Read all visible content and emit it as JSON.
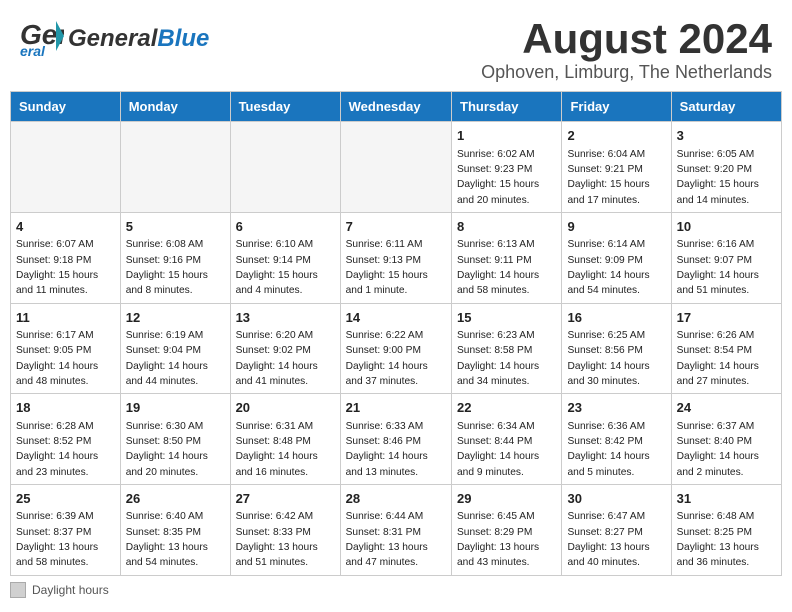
{
  "header": {
    "logo_general": "General",
    "logo_blue": "Blue",
    "month_year": "August 2024",
    "location": "Ophoven, Limburg, The Netherlands"
  },
  "weekdays": [
    "Sunday",
    "Monday",
    "Tuesday",
    "Wednesday",
    "Thursday",
    "Friday",
    "Saturday"
  ],
  "weeks": [
    [
      {
        "day": "",
        "info": ""
      },
      {
        "day": "",
        "info": ""
      },
      {
        "day": "",
        "info": ""
      },
      {
        "day": "",
        "info": ""
      },
      {
        "day": "1",
        "info": "Sunrise: 6:02 AM\nSunset: 9:23 PM\nDaylight: 15 hours\nand 20 minutes."
      },
      {
        "day": "2",
        "info": "Sunrise: 6:04 AM\nSunset: 9:21 PM\nDaylight: 15 hours\nand 17 minutes."
      },
      {
        "day": "3",
        "info": "Sunrise: 6:05 AM\nSunset: 9:20 PM\nDaylight: 15 hours\nand 14 minutes."
      }
    ],
    [
      {
        "day": "4",
        "info": "Sunrise: 6:07 AM\nSunset: 9:18 PM\nDaylight: 15 hours\nand 11 minutes."
      },
      {
        "day": "5",
        "info": "Sunrise: 6:08 AM\nSunset: 9:16 PM\nDaylight: 15 hours\nand 8 minutes."
      },
      {
        "day": "6",
        "info": "Sunrise: 6:10 AM\nSunset: 9:14 PM\nDaylight: 15 hours\nand 4 minutes."
      },
      {
        "day": "7",
        "info": "Sunrise: 6:11 AM\nSunset: 9:13 PM\nDaylight: 15 hours\nand 1 minute."
      },
      {
        "day": "8",
        "info": "Sunrise: 6:13 AM\nSunset: 9:11 PM\nDaylight: 14 hours\nand 58 minutes."
      },
      {
        "day": "9",
        "info": "Sunrise: 6:14 AM\nSunset: 9:09 PM\nDaylight: 14 hours\nand 54 minutes."
      },
      {
        "day": "10",
        "info": "Sunrise: 6:16 AM\nSunset: 9:07 PM\nDaylight: 14 hours\nand 51 minutes."
      }
    ],
    [
      {
        "day": "11",
        "info": "Sunrise: 6:17 AM\nSunset: 9:05 PM\nDaylight: 14 hours\nand 48 minutes."
      },
      {
        "day": "12",
        "info": "Sunrise: 6:19 AM\nSunset: 9:04 PM\nDaylight: 14 hours\nand 44 minutes."
      },
      {
        "day": "13",
        "info": "Sunrise: 6:20 AM\nSunset: 9:02 PM\nDaylight: 14 hours\nand 41 minutes."
      },
      {
        "day": "14",
        "info": "Sunrise: 6:22 AM\nSunset: 9:00 PM\nDaylight: 14 hours\nand 37 minutes."
      },
      {
        "day": "15",
        "info": "Sunrise: 6:23 AM\nSunset: 8:58 PM\nDaylight: 14 hours\nand 34 minutes."
      },
      {
        "day": "16",
        "info": "Sunrise: 6:25 AM\nSunset: 8:56 PM\nDaylight: 14 hours\nand 30 minutes."
      },
      {
        "day": "17",
        "info": "Sunrise: 6:26 AM\nSunset: 8:54 PM\nDaylight: 14 hours\nand 27 minutes."
      }
    ],
    [
      {
        "day": "18",
        "info": "Sunrise: 6:28 AM\nSunset: 8:52 PM\nDaylight: 14 hours\nand 23 minutes."
      },
      {
        "day": "19",
        "info": "Sunrise: 6:30 AM\nSunset: 8:50 PM\nDaylight: 14 hours\nand 20 minutes."
      },
      {
        "day": "20",
        "info": "Sunrise: 6:31 AM\nSunset: 8:48 PM\nDaylight: 14 hours\nand 16 minutes."
      },
      {
        "day": "21",
        "info": "Sunrise: 6:33 AM\nSunset: 8:46 PM\nDaylight: 14 hours\nand 13 minutes."
      },
      {
        "day": "22",
        "info": "Sunrise: 6:34 AM\nSunset: 8:44 PM\nDaylight: 14 hours\nand 9 minutes."
      },
      {
        "day": "23",
        "info": "Sunrise: 6:36 AM\nSunset: 8:42 PM\nDaylight: 14 hours\nand 5 minutes."
      },
      {
        "day": "24",
        "info": "Sunrise: 6:37 AM\nSunset: 8:40 PM\nDaylight: 14 hours\nand 2 minutes."
      }
    ],
    [
      {
        "day": "25",
        "info": "Sunrise: 6:39 AM\nSunset: 8:37 PM\nDaylight: 13 hours\nand 58 minutes."
      },
      {
        "day": "26",
        "info": "Sunrise: 6:40 AM\nSunset: 8:35 PM\nDaylight: 13 hours\nand 54 minutes."
      },
      {
        "day": "27",
        "info": "Sunrise: 6:42 AM\nSunset: 8:33 PM\nDaylight: 13 hours\nand 51 minutes."
      },
      {
        "day": "28",
        "info": "Sunrise: 6:44 AM\nSunset: 8:31 PM\nDaylight: 13 hours\nand 47 minutes."
      },
      {
        "day": "29",
        "info": "Sunrise: 6:45 AM\nSunset: 8:29 PM\nDaylight: 13 hours\nand 43 minutes."
      },
      {
        "day": "30",
        "info": "Sunrise: 6:47 AM\nSunset: 8:27 PM\nDaylight: 13 hours\nand 40 minutes."
      },
      {
        "day": "31",
        "info": "Sunrise: 6:48 AM\nSunset: 8:25 PM\nDaylight: 13 hours\nand 36 minutes."
      }
    ]
  ],
  "legend": {
    "swatch_label": "Daylight hours"
  }
}
